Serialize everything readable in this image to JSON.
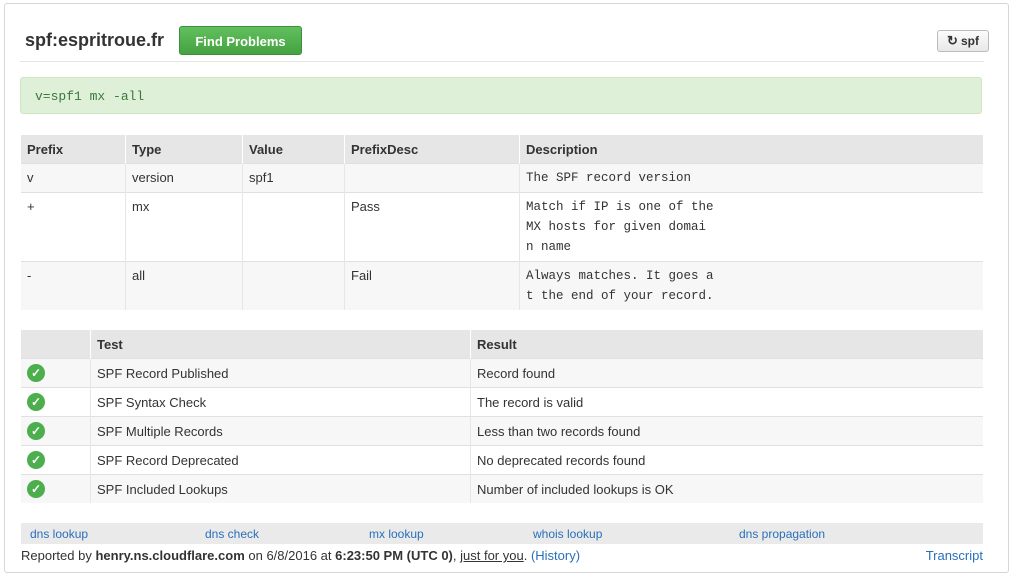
{
  "header": {
    "title": "spf:espritroue.fr",
    "find_button": "Find Problems",
    "spf_button": "spf",
    "spf_icon": "refresh-icon"
  },
  "record": "v=spf1 mx -all",
  "spf_table": {
    "columns": [
      "Prefix",
      "Type",
      "Value",
      "PrefixDesc",
      "Description"
    ],
    "rows": [
      {
        "prefix": "v",
        "type": "version",
        "value": "spf1",
        "prefixdesc": "",
        "description": [
          "The SPF record version"
        ]
      },
      {
        "prefix": "+",
        "type": "mx",
        "value": "",
        "prefixdesc": "Pass",
        "description": [
          "Match if IP is one of the",
          "MX hosts for given domai",
          "n name"
        ]
      },
      {
        "prefix": "-",
        "type": "all",
        "value": "",
        "prefixdesc": "Fail",
        "description": [
          "Always matches. It goes a",
          "t the end of your record."
        ]
      }
    ]
  },
  "test_table": {
    "columns": [
      "",
      "Test",
      "Result"
    ],
    "rows": [
      {
        "status": "check-icon",
        "test": "SPF Record Published",
        "result": "Record found"
      },
      {
        "status": "check-icon",
        "test": "SPF Syntax Check",
        "result": "The record is valid"
      },
      {
        "status": "check-icon",
        "test": "SPF Multiple Records",
        "result": "Less than two records found"
      },
      {
        "status": "check-icon",
        "test": "SPF Record Deprecated",
        "result": "No deprecated records found"
      },
      {
        "status": "check-icon",
        "test": "SPF Included Lookups",
        "result": "Number of included lookups is OK"
      }
    ]
  },
  "links": [
    "dns lookup",
    "dns check",
    "mx lookup",
    "whois lookup",
    "dns propagation"
  ],
  "footer": {
    "reported_by": "Reported by",
    "host": "henry.ns.cloudflare.com",
    "on": "on 6/8/2016 at",
    "time": "6:23:50 PM (UTC 0)",
    "just_for_you": "just for you",
    "history": "(History)",
    "transcript": "Transcript"
  },
  "colors": {
    "accent_green": "#4cae4c",
    "link": "#2a6fba",
    "record_bg": "#dff0d8"
  }
}
